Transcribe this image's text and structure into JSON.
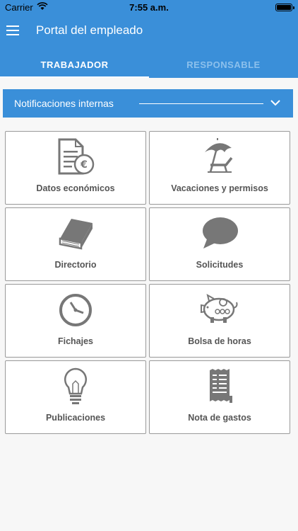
{
  "statusbar": {
    "carrier": "Carrier",
    "time": "7:55 a.m."
  },
  "header": {
    "title": "Portal del empleado"
  },
  "tabs": [
    {
      "label": "TRABAJADOR"
    },
    {
      "label": "RESPONSABLE"
    }
  ],
  "notifications": {
    "label": "Notificaciones internas"
  },
  "cards": [
    {
      "label": "Datos económicos",
      "icon": "document-euro-icon"
    },
    {
      "label": "Vacaciones y permisos",
      "icon": "beach-umbrella-icon"
    },
    {
      "label": "Directorio",
      "icon": "book-icon"
    },
    {
      "label": "Solicitudes",
      "icon": "speech-bubble-icon"
    },
    {
      "label": "Fichajes",
      "icon": "clock-icon"
    },
    {
      "label": "Bolsa de horas",
      "icon": "piggy-bank-icon"
    },
    {
      "label": "Publicaciones",
      "icon": "lightbulb-icon"
    },
    {
      "label": "Nota de gastos",
      "icon": "receipt-icon"
    }
  ],
  "colors": {
    "primary": "#3a8fd9",
    "icon": "#777777",
    "text": "#555555"
  }
}
